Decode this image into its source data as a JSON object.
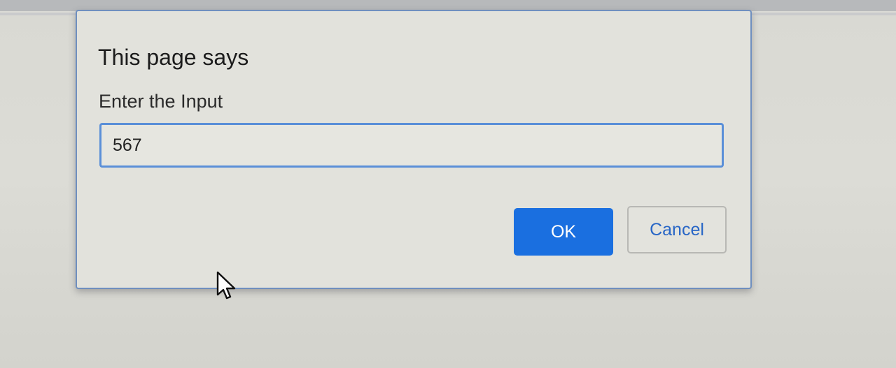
{
  "dialog": {
    "title": "This page says",
    "message": "Enter the Input",
    "input_value": "567",
    "ok_label": "OK",
    "cancel_label": "Cancel"
  },
  "icons": {
    "pointer": "mouse-pointer-icon"
  },
  "colors": {
    "ok_button": "#1a6fe0",
    "cancel_text": "#2866c6",
    "input_border": "#5a8fd8"
  }
}
